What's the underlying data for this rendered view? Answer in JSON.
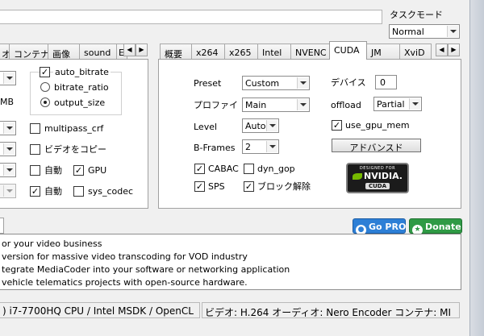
{
  "task_mode": {
    "label": "タスクモード",
    "value": "Normal"
  },
  "left_tabs": [
    "オ",
    "コンテナ",
    "画像",
    "sound",
    "E"
  ],
  "right_tabs": [
    "概要",
    "x264",
    "x265",
    "Intel",
    "NVENC",
    "CUDA",
    "JM",
    "XviD"
  ],
  "right_active_tab": "CUDA",
  "left_panel": {
    "mb_label": "MB",
    "auto_bitrate": "auto_bitrate",
    "bitrate_ratio": "bitrate_ratio",
    "output_size": "output_size",
    "multipass_crf": "multipass_crf",
    "copy_video": "ビデオをコピー",
    "auto1": "自動",
    "gpu": "GPU",
    "auto2": "自動",
    "sys_codec": "sys_codec"
  },
  "cuda_panel": {
    "preset_label": "Preset",
    "preset_value": "Custom",
    "profile_label": "プロファイ",
    "profile_value": "Main",
    "level_label": "Level",
    "level_value": "Auto",
    "bframes_label": "B-Frames",
    "bframes_value": "2",
    "device_label": "デバイス",
    "device_value": "0",
    "offload_label": "offload",
    "offload_value": "Partial",
    "use_gpu_mem": "use_gpu_mem",
    "advanced_button": "アドバンスド",
    "cabac": "CABAC",
    "dyn_gop": "dyn_gop",
    "sps": "SPS",
    "deblock": "ブロック解除",
    "nvidia_badge_top": "DESIGNED FOR",
    "nvidia_badge_brand": "NVIDIA.",
    "nvidia_badge_bottom": "CUDA"
  },
  "buttons": {
    "go_pro": "Go PRO",
    "donate": "Donate"
  },
  "messages": [
    "or your video business",
    " version for massive video transcoding for VOD industry",
    "tegrate MediaCoder into your software or networking application",
    "vehicle telematics projects with open-source hardware."
  ],
  "status_bar": {
    "cpu": ") i7-7700HQ CPU  / Intel MSDK / OpenCL",
    "summary": "ビデオ: H.264  オーディオ: Nero Encoder  コンテナ: MI"
  },
  "colors": {
    "go_pro_bg": "#2d7fd6",
    "donate_bg": "#2f9a45",
    "nvidia_green": "#76b900"
  }
}
